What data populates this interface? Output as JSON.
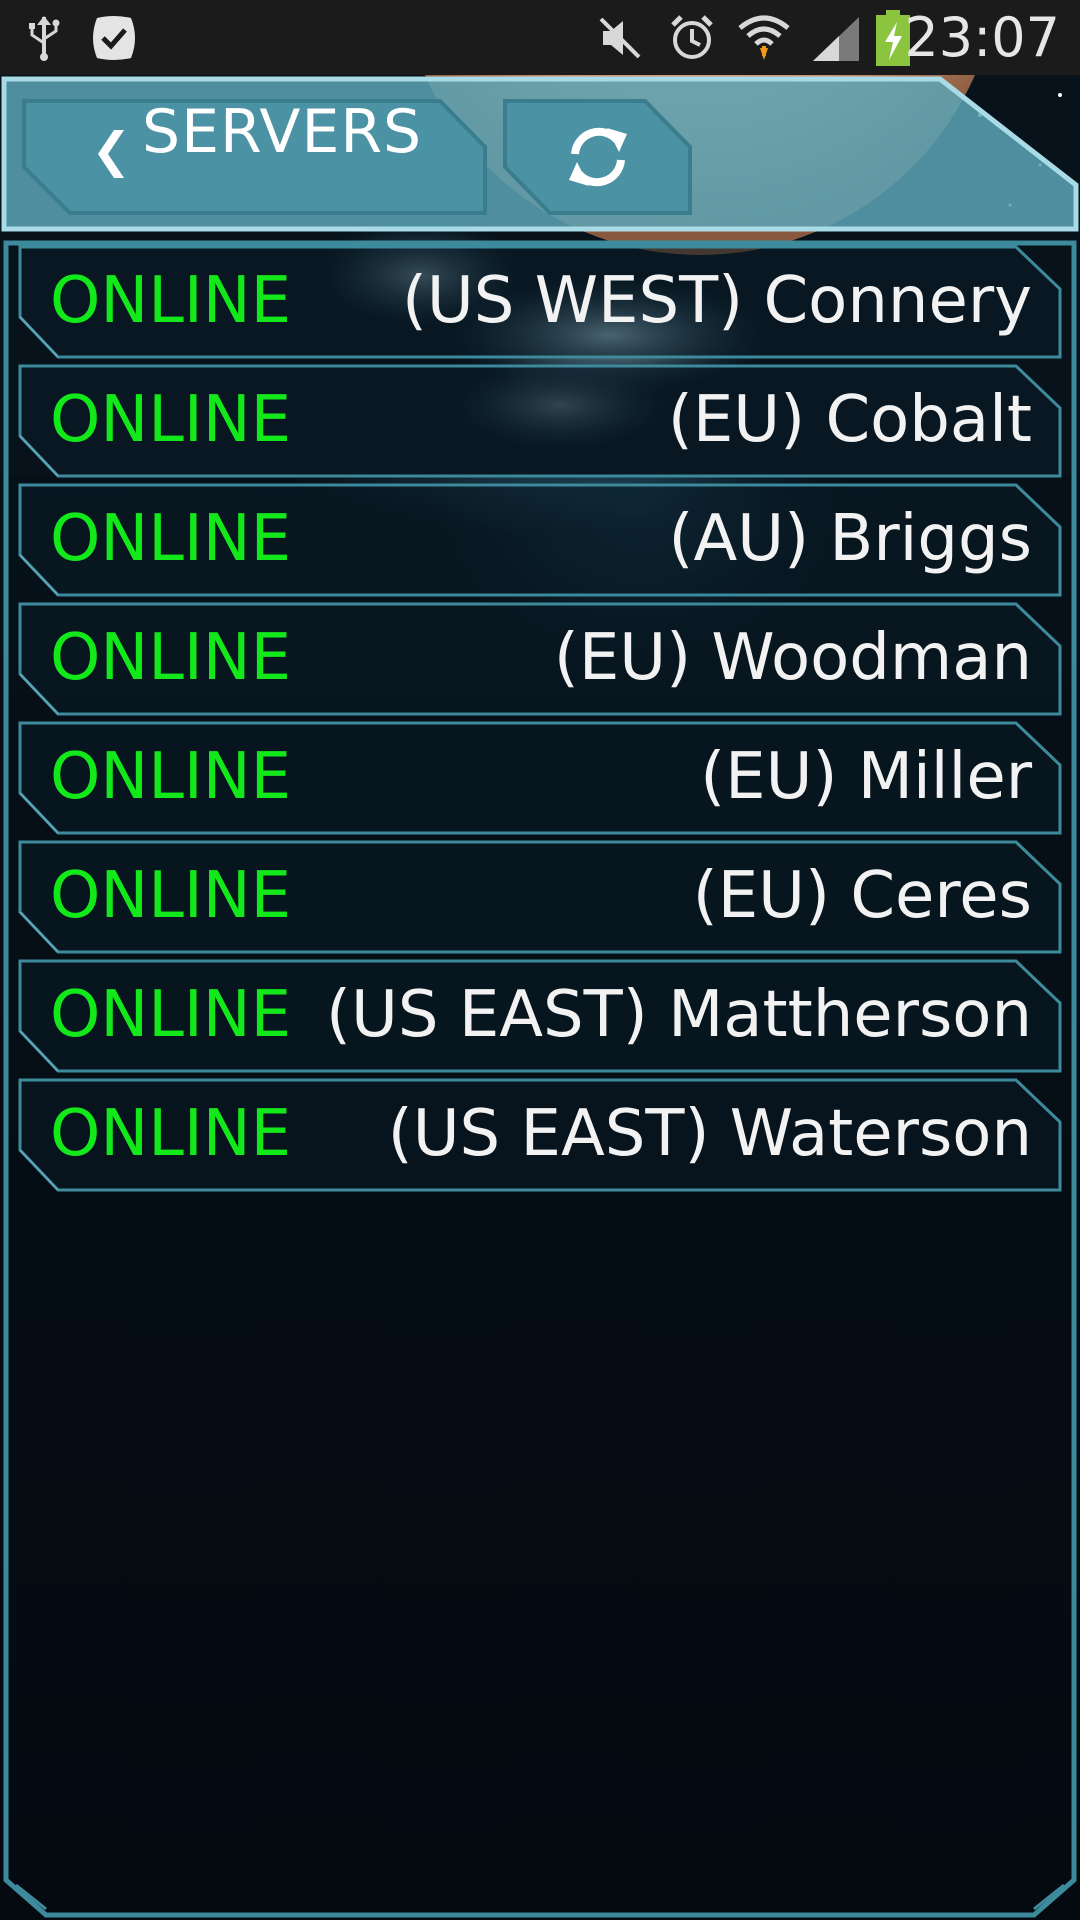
{
  "status_bar": {
    "time": "23:07",
    "icons": [
      "usb-icon",
      "checkmark-app-icon",
      "mute-icon",
      "alarm-icon",
      "wifi-icon",
      "signal-icon",
      "battery-charging-icon"
    ]
  },
  "header": {
    "title": "SERVERS",
    "back_icon": "chevron-left-icon",
    "refresh_icon": "refresh-icon"
  },
  "servers": [
    {
      "status": "ONLINE",
      "name": "(US WEST) Connery"
    },
    {
      "status": "ONLINE",
      "name": "(EU) Cobalt"
    },
    {
      "status": "ONLINE",
      "name": "(AU) Briggs"
    },
    {
      "status": "ONLINE",
      "name": "(EU) Woodman"
    },
    {
      "status": "ONLINE",
      "name": "(EU) Miller"
    },
    {
      "status": "ONLINE",
      "name": "(EU) Ceres"
    },
    {
      "status": "ONLINE",
      "name": "(US EAST) Mattherson"
    },
    {
      "status": "ONLINE",
      "name": "(US EAST) Waterson"
    }
  ],
  "colors": {
    "online": "#13e81b",
    "frame": "#3d8a9c",
    "header_panel": "#5aa4b6",
    "background": "#050b11"
  }
}
